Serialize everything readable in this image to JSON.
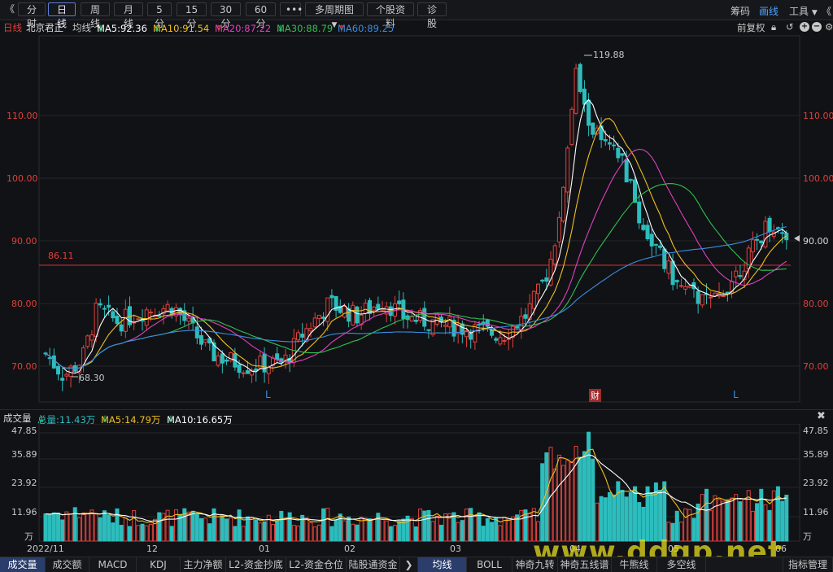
{
  "toolbar": {
    "back_icon": "《",
    "buttons": [
      "分时",
      "日线",
      "周线",
      "月线",
      "5分",
      "15分",
      "30分",
      "60分",
      "•••",
      "多周期图",
      "个股资料",
      "诊股"
    ],
    "active": "日线",
    "right": {
      "chips": "筹码",
      "draw": "画线",
      "tools": "工具"
    }
  },
  "info": {
    "period": "日线",
    "stock_name": "北京君正",
    "ma_label": "均线",
    "ma5": "MA5:92.36",
    "ma10": "MA10:91.54",
    "ma20": "MA20:87.22",
    "ma30": "MA30:88.79",
    "ma60": "MA60:89.25",
    "adjust": "前复权"
  },
  "price_axis": {
    "labels": [
      "110.00",
      "100.00",
      "90.00",
      "80.00",
      "70.00"
    ],
    "current_right": "90.00"
  },
  "annotations": {
    "high": "119.88",
    "low": "68.30",
    "hline": "86.11",
    "markers": [
      "L",
      "财",
      "L"
    ]
  },
  "colors": {
    "up": "#e0403a",
    "down": "#2dbdbd",
    "ma5": "#ffffff",
    "ma10": "#f0c020",
    "ma20": "#e040c0",
    "ma30": "#30c050",
    "ma60": "#3a8de0",
    "hline": "#c03030"
  },
  "volume": {
    "title": "成交量",
    "total": "总量:11.43万",
    "ma5": "MA5:14.79万",
    "ma10": "MA10:16.65万",
    "axis_labels": [
      "47.85",
      "35.89",
      "23.92",
      "11.96",
      "万"
    ]
  },
  "date_axis": [
    "2022/11",
    "12",
    "01",
    "02",
    "03",
    "04",
    "05",
    "06"
  ],
  "bottom_tabs": [
    "成交量",
    "成交额",
    "MACD",
    "KDJ",
    "主力净额",
    "L2-资金抄底",
    "L2-资金仓位",
    "陆股通资金",
    "均线",
    "BOLL",
    "神奇九转",
    "神奇五线谱",
    "牛熊线",
    "多空线",
    "指标管理"
  ],
  "bottom_active": [
    "成交量",
    "均线"
  ],
  "watermark": "www.ddgp.net"
}
